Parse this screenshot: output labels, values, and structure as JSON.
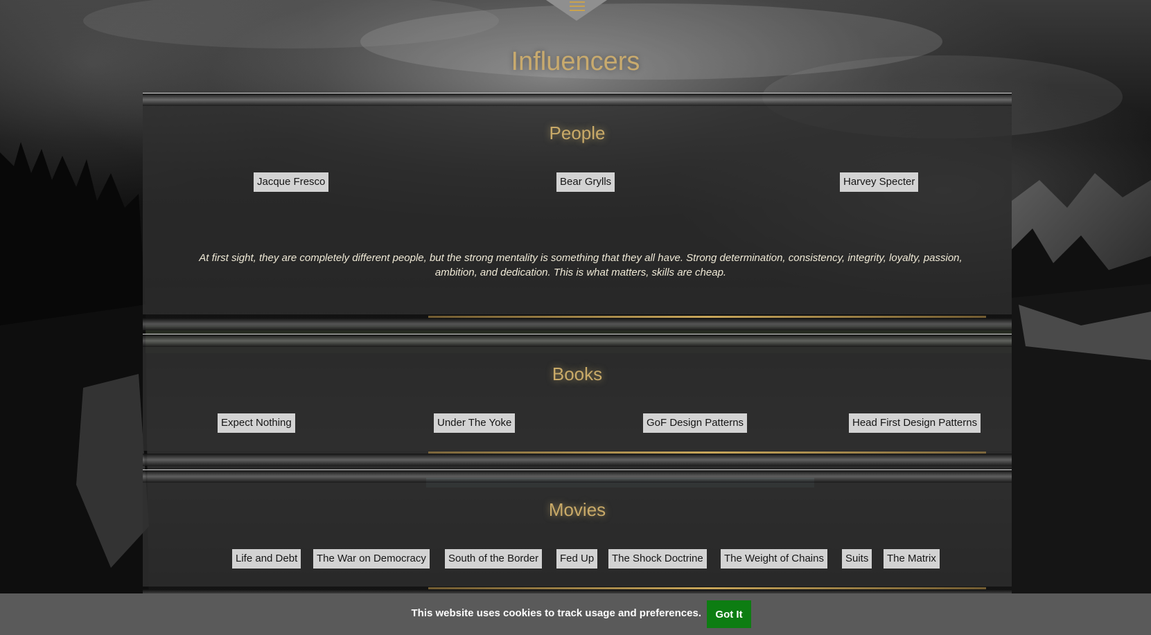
{
  "nav": {
    "menu_icon": "hamburger-menu-icon"
  },
  "page": {
    "title": "Influencers"
  },
  "people": {
    "title": "People",
    "items": [
      "Jacque Fresco",
      "Bear Grylls",
      "Harvey Specter"
    ],
    "quote": "At first sight, they are completely different people, but the strong mentality is something that they all have. Strong determination, consistency, integrity, loyalty, passion, ambition, and dedication. This is what matters, skills are cheap."
  },
  "books": {
    "title": "Books",
    "items": [
      "Expect Nothing",
      "Under The Yoke",
      "GoF Design Patterns",
      "Head First Design Patterns"
    ]
  },
  "movies": {
    "title": "Movies",
    "items": [
      "Life and Debt",
      "The War on Democracy",
      "South of the Border",
      "Fed Up",
      "The Shock Doctrine",
      "The Weight of Chains",
      "Suits",
      "The Matrix"
    ]
  },
  "cookie": {
    "message": "This website uses cookies to track usage and preferences.",
    "button_label": "Got It"
  },
  "colors": {
    "accent_gold": "#c8aa6e",
    "chip_background": "#d3d3d3",
    "cookie_bar": "#5a5a5a",
    "cookie_button": "#0d7d12"
  }
}
